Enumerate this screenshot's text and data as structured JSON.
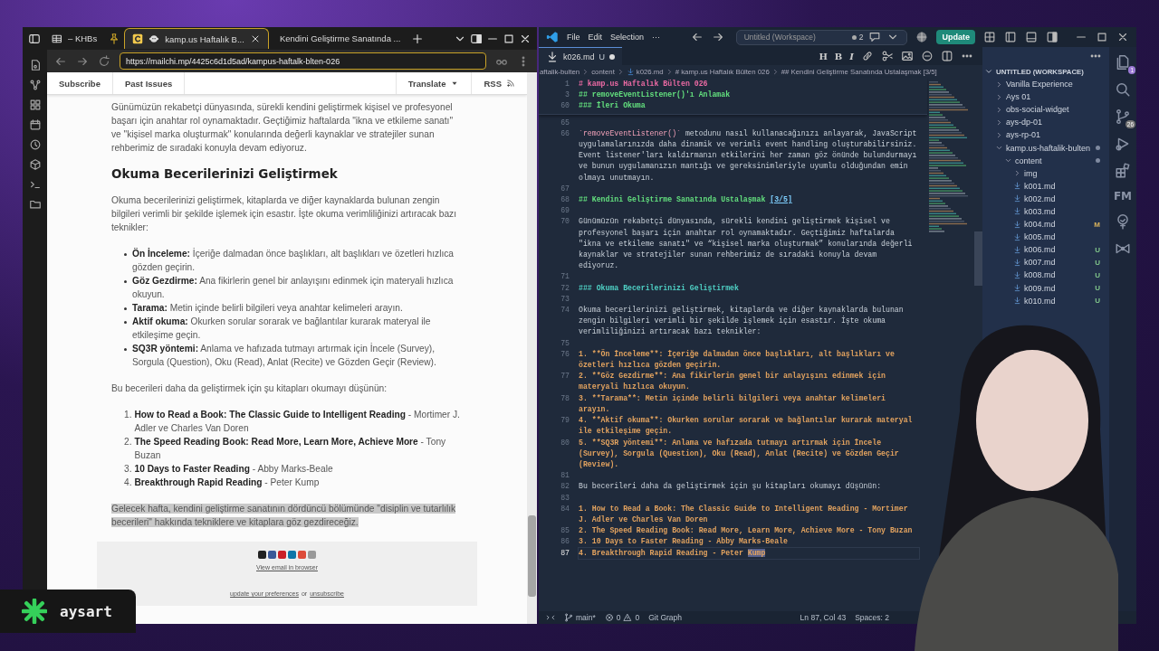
{
  "browser": {
    "tabs": [
      {
        "label": "– KHBs",
        "selected": false
      },
      {
        "label": "kamp.us Haftalık B...",
        "selected": true
      },
      {
        "label": "Kendini Geliştirme Sanatında ...",
        "selected": false
      }
    ],
    "url": "https://mailchi.mp/4425c6d1d5ad/kampus-haftalk-blten-026",
    "nav": {
      "links": [
        "Subscribe",
        "Past Issues"
      ],
      "translate": "Translate",
      "rss": "RSS"
    },
    "article": {
      "intro": "Günümüzün rekabetçi dünyasında, sürekli kendini geliştirmek kişisel ve profesyonel başarı için anahtar rol oynamaktadır. Geçtiğimiz haftalarda  \"ikna ve etkileme sanatı\" ve \"kişisel marka oluşturmak\" konularında değerli kaynaklar ve stratejiler sunan rehberimiz de sıradaki konuyla devam ediyoruz.",
      "heading": "Okuma Becerilerinizi Geliştirmek",
      "paragraph": "Okuma becerilerinizi geliştirmek, kitaplarda ve diğer kaynaklarda bulunan zengin bilgileri verimli bir şekilde işlemek için esastır. İşte okuma verimliliğinizi artıracak bazı teknikler:",
      "techniques": [
        "**Ön İnceleme:** İçeriğe dalmadan önce başlıkları, alt başlıkları ve özetleri hızlıca gözden geçirin.",
        "**Göz Gezdirme:** Ana fikirlerin genel bir anlayışını edinmek için materyali hızlıca okuyun.",
        "**Tarama:** Metin içinde belirli bilgileri veya anahtar kelimeleri arayın.",
        "**Aktif okuma:** Okurken sorular sorarak ve bağlantılar kurarak materyal ile etkileşime geçin.",
        "**SQ3R yöntemi:** Anlama ve hafızada tutmayı artırmak için İncele (Survey), Sorgula (Question), Oku (Read), Anlat (Recite) ve Gözden Geçir (Review)."
      ],
      "books_intro": "Bu becerileri daha da geliştirmek için şu kitapları okumayı düşünün:",
      "books": [
        {
          "number": "1.",
          "text": "**How to Read a Book: The Classic Guide to Intelligent Reading** - Mortimer J. Adler ve Charles Van Doren"
        },
        {
          "number": "2.",
          "text": "**The Speed Reading Book: Read More, Learn More, Achieve More** - Tony Buzan"
        },
        {
          "number": "3.",
          "text": "**10 Days to Faster Reading** - Abby Marks-Beale"
        },
        {
          "number": "4.",
          "text": "**Breakthrough Rapid Reading** - Peter Kump"
        }
      ],
      "closing": {
        "text": "Gelecek hafta, kendini geliştirme sanatının dördüncü bölümünde \"disiplin ve tutarlılık becerileri\" hakkında tekniklere ve kitaplara göz gezdireceğiz.",
        "selected": true
      }
    },
    "footer": {
      "view_link": "View email in browser",
      "preferences_link": "update your preferences",
      "or": "or",
      "unsubscribe_link": "unsubscribe"
    }
  },
  "vscode": {
    "menu": [
      "File",
      "Edit",
      "Selection",
      "···"
    ],
    "command_center": "Untitled (Workspace)",
    "notifications": "2",
    "update_button": "Update",
    "editor_tab": {
      "label": "k026.md",
      "status": "U",
      "dirty": true
    },
    "format_buttons": [
      "H",
      "B",
      "I"
    ],
    "breadcrumbs": [
      "aftalik-bulten",
      "content",
      "k026.md",
      "# kamp.us Haftalık Bülten 026",
      "## Kendini Geliştirme Sanatında Ustalaşmak [3/5]"
    ],
    "sticky_lines": [
      {
        "number": "1",
        "kind": "h1",
        "text": "# kamp.us Haftalık Bülten 026"
      },
      {
        "number": "3",
        "kind": "h2",
        "text": "## removeEventListener()'ı Anlamak"
      },
      {
        "number": "60",
        "kind": "h2",
        "text": "### İleri Okuma"
      }
    ],
    "lines": [
      {
        "number": "65",
        "current": false
      },
      {
        "number": "66",
        "current": false,
        "parts": [
          {
            "kind": "code",
            "text": "`removeEventListener()`"
          },
          {
            "kind": "text",
            "text": " metodunu nasıl kullanacağınızı anlayarak, JavaScript uygulamalarınızda daha dinamik ve verimli event handling oluşturabilirsiniz. Event listener'ları kaldırmanın etkilerini her zaman göz önünde bulundurmayı ve bunun uygulamanızın mantığı ve gereksinimleriyle uyumlu olduğundan emin olmayı unutmayın."
          }
        ]
      },
      {
        "number": "67",
        "current": false
      },
      {
        "number": "68",
        "current": false,
        "parts": [
          {
            "kind": "h2",
            "text": "## Kendini Geliştirme Sanatında Ustalaşmak "
          },
          {
            "kind": "link",
            "text": "[3/5]"
          }
        ]
      },
      {
        "number": "69",
        "current": false
      },
      {
        "number": "70",
        "current": false,
        "parts": [
          {
            "kind": "text",
            "text": "Günümüzün rekabetçi dünyasında, sürekli kendini geliştirmek kişisel ve profesyonel başarı için anahtar rol oynamaktadır. Geçtiğimiz haftalarda \"ikna ve etkileme sanatı\" ve “kişisel marka oluşturmak” konularında değerli kaynaklar ve stratejiler sunan rehberimiz de sıradaki konuyla devam ediyoruz."
          }
        ]
      },
      {
        "number": "71",
        "current": false
      },
      {
        "number": "72",
        "current": false,
        "parts": [
          {
            "kind": "h3",
            "text": "### Okuma Becerilerinizi Geliştirmek"
          }
        ]
      },
      {
        "number": "73",
        "current": false
      },
      {
        "number": "74",
        "current": false,
        "parts": [
          {
            "kind": "text",
            "text": "Okuma becerilerinizi geliştirmek, kitaplarda ve diğer kaynaklarda bulunan zengin bilgileri verimli bir şekilde işlemek için esastır. İşte okuma verimliliğinizi artıracak bazı teknikler:"
          }
        ]
      },
      {
        "number": "75",
        "current": false
      },
      {
        "number": "76",
        "current": false,
        "parts": [
          {
            "kind": "list",
            "text": "1. **Ön İnceleme**: İçeriğe dalmadan önce başlıkları, alt başlıkları ve özetleri hızlıca gözden geçirin."
          }
        ]
      },
      {
        "number": "77",
        "current": false,
        "parts": [
          {
            "kind": "list",
            "text": "2. **Göz Gezdirme**: Ana fikirlerin genel bir anlayışını edinmek için materyali hızlıca okuyun."
          }
        ]
      },
      {
        "number": "78",
        "current": false,
        "parts": [
          {
            "kind": "list",
            "text": "3. **Tarama**: Metin içinde belirli bilgileri veya anahtar kelimeleri arayın."
          }
        ]
      },
      {
        "number": "79",
        "current": false,
        "parts": [
          {
            "kind": "list",
            "text": "4. **Aktif okuma**: Okurken sorular sorarak ve bağlantılar kurarak materyal ile etkileşime geçin."
          }
        ]
      },
      {
        "number": "80",
        "current": false,
        "parts": [
          {
            "kind": "list",
            "text": "5. **SQ3R yöntemi**: Anlama ve hafızada tutmayı artırmak için İncele (Survey), Sorgula (Question), Oku (Read), Anlat (Recite) ve Gözden Geçir (Review)."
          }
        ]
      },
      {
        "number": "81",
        "current": false
      },
      {
        "number": "82",
        "current": false,
        "parts": [
          {
            "kind": "text",
            "text": "Bu becerileri daha da geliştirmek için şu kitapları okumayı düşünün:"
          }
        ]
      },
      {
        "number": "83",
        "current": false
      },
      {
        "number": "84",
        "current": false,
        "parts": [
          {
            "kind": "list",
            "text": "1. How to Read a Book: The Classic Guide to Intelligent Reading - Mortimer J. Adler ve Charles Van Doren"
          }
        ]
      },
      {
        "number": "85",
        "current": false,
        "parts": [
          {
            "kind": "list",
            "text": "2. The Speed Reading Book: Read More, Learn More, Achieve More - Tony Buzan"
          }
        ]
      },
      {
        "number": "86",
        "current": false,
        "parts": [
          {
            "kind": "list",
            "text": "3. 10 Days to Faster Reading - Abby Marks-Beale"
          }
        ]
      },
      {
        "number": "87",
        "current": true,
        "parts": [
          {
            "kind": "list",
            "text": "4. Breakthrough Rapid Reading - Peter "
          },
          {
            "kind": "selection",
            "text": "Kump"
          }
        ]
      }
    ],
    "explorer": {
      "title": "UNTITLED (WORKSPACE)",
      "tree": [
        {
          "label": "Vanilla Experience",
          "kind": "folder",
          "expanded": false,
          "changes": false
        },
        {
          "label": "Ays 01",
          "kind": "folder",
          "expanded": false,
          "changes": false
        },
        {
          "label": "obs-social-widget",
          "kind": "folder",
          "expanded": false,
          "changes": false
        },
        {
          "label": "ays-dp-01",
          "kind": "folder",
          "expanded": false,
          "changes": false
        },
        {
          "label": "ays-rp-01",
          "kind": "folder",
          "expanded": false,
          "changes": false
        },
        {
          "label": "kamp.us-haftalik-bulten",
          "kind": "folder",
          "expanded": true,
          "changes": true,
          "children": [
            {
              "label": "content",
              "kind": "folder",
              "expanded": true,
              "changes": true,
              "children": [
                {
                  "label": "img",
                  "kind": "folder",
                  "expanded": false,
                  "changes": false
                },
                {
                  "label": "k001.md",
                  "kind": "file"
                },
                {
                  "label": "k002.md",
                  "kind": "file"
                },
                {
                  "label": "k003.md",
                  "kind": "file"
                },
                {
                  "label": "k004.md",
                  "kind": "file",
                  "status": "M"
                },
                {
                  "label": "k005.md",
                  "kind": "file"
                },
                {
                  "label": "k006.md",
                  "kind": "file",
                  "status": "U"
                },
                {
                  "label": "k007.md",
                  "kind": "file",
                  "status": "U"
                },
                {
                  "label": "k008.md",
                  "kind": "file",
                  "status": "U"
                },
                {
                  "label": "k009.md",
                  "kind": "file",
                  "status": "U"
                },
                {
                  "label": "k010.md",
                  "kind": "file",
                  "status": "U"
                }
              ]
            }
          ]
        }
      ]
    },
    "activity": {
      "files_badge": "1",
      "source_control_badge": "26",
      "fm_label": "FM"
    },
    "status_bar": {
      "branch": "main*",
      "errors": "0",
      "warnings": "0",
      "git_graph": "Git Graph",
      "position": "Ln 87, Col 43",
      "spaces": "Spaces: 2"
    }
  },
  "overlay": {
    "channel_name": "aysart"
  }
}
